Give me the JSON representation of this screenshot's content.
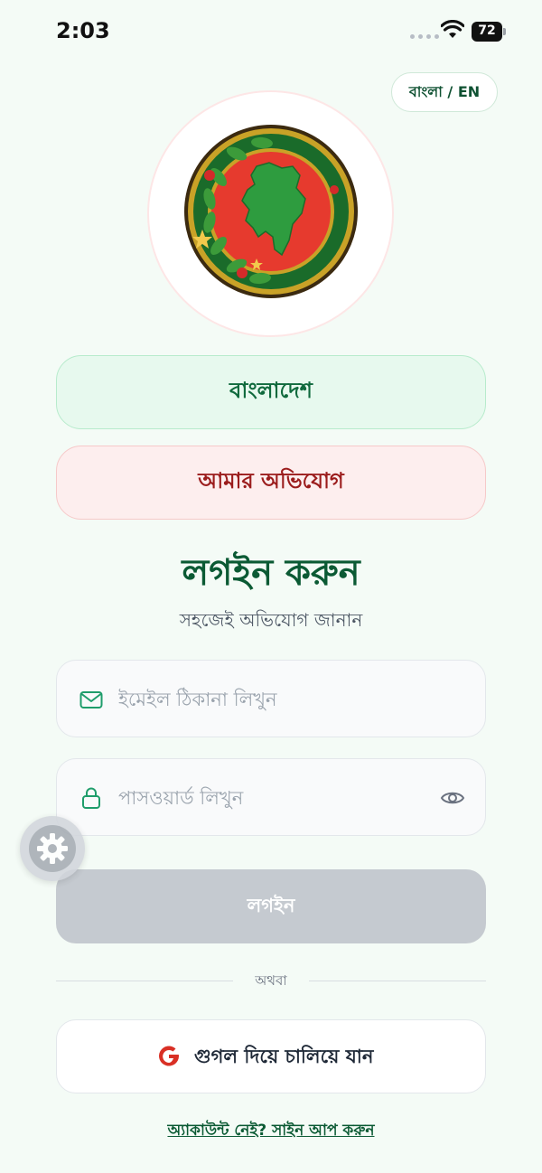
{
  "status_bar": {
    "time": "2:03",
    "battery": "72",
    "icons": [
      "signal-dots-icon",
      "wifi-icon",
      "battery-icon"
    ]
  },
  "language_toggle": {
    "label": "বাংলা / EN"
  },
  "logo": {
    "icon": "bangladesh-map-emblem"
  },
  "country_button": {
    "label": "বাংলাদেশ"
  },
  "complaint_button": {
    "label": "আমার অভিযোগ"
  },
  "login_section": {
    "title": "লগইন করুন",
    "subtitle": "সহজেই অভিযোগ জানান"
  },
  "email_field": {
    "placeholder": "ইমেইল ঠিকানা লিখুন",
    "value": "",
    "icon": "mail-icon"
  },
  "password_field": {
    "placeholder": "পাসওয়ার্ড লিখুন",
    "value": "",
    "icon": "lock-icon",
    "toggle_icon": "eye-icon"
  },
  "login_button": {
    "label": "লগইন"
  },
  "divider": {
    "label": "অথবা"
  },
  "google_button": {
    "label": "গুগল দিয়ে চালিয়ে যান",
    "icon": "google-icon"
  },
  "signup": {
    "label": "অ্যাকাউন্ট নেই? সাইন আপ করুন"
  },
  "settings_fab": {
    "icon": "gear-icon"
  },
  "colors": {
    "background": "#f4fbf6",
    "brand_green": "#0b5a34",
    "brand_red": "#9b1c1c",
    "disabled": "#c5cad0"
  }
}
